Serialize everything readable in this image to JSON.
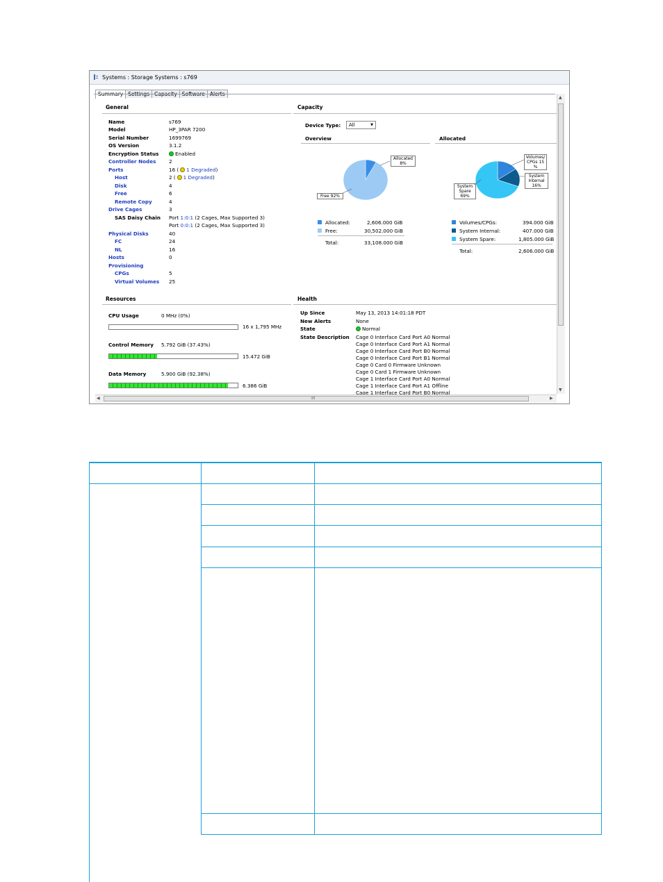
{
  "window": {
    "title": "Systems : Storage Systems : s769",
    "tabs": [
      "Summary",
      "Settings",
      "Capacity",
      "Software",
      "Alerts"
    ]
  },
  "general": {
    "heading": "General",
    "name_label": "Name",
    "name": "s769",
    "model_label": "Model",
    "model": "HP_3PAR 7200",
    "serial_label": "Serial Number",
    "serial": "1699769",
    "os_label": "OS Version",
    "os": "3.1.2",
    "encryption_label": "Encryption Status",
    "encryption": "Enabled",
    "controller_nodes_label": "Controller Nodes",
    "controller_nodes": "2",
    "ports_label": "Ports",
    "ports_count": "16 (",
    "ports_degraded": "1 Degraded",
    "ports_close": ")",
    "host_label": "Host",
    "host_count": "2 (",
    "host_degraded": "1 Degraded",
    "host_close": ")",
    "disk_label": "Disk",
    "disk": "4",
    "free_label": "Free",
    "free": "6",
    "remote_copy_label": "Remote Copy",
    "remote_copy": "4",
    "drive_cages_label": "Drive Cages",
    "drive_cages": "3",
    "sas_label": "SAS Daisy Chain",
    "sas_port_word": "Port ",
    "sas_link1": "1:0:1",
    "sas_rest1": " (2 Cages, Max Supported 3)",
    "sas_link2": "0:0:1",
    "sas_rest2": " (2 Cages, Max Supported 3)",
    "physical_disks_label": "Physical Disks",
    "physical_disks": "40",
    "fc_label": "FC",
    "fc": "24",
    "nl_label": "NL",
    "nl": "16",
    "hosts_label": "Hosts",
    "hosts": "0",
    "provisioning_label": "Provisioning",
    "cpgs_label": "CPGs",
    "cpgs": "5",
    "vv_label": "Virtual Volumes",
    "vv": "25"
  },
  "resources": {
    "heading": "Resources",
    "cpu_label": "CPU Usage",
    "cpu_value": "0 MHz (0%)",
    "cpu_max": "16 x 1,795 MHz",
    "cpu_fraction": 0.0,
    "control_label": "Control Memory",
    "control_value": "5.792 GiB (37.43%)",
    "control_max": "15.472 GiB",
    "control_fraction": 0.3743,
    "data_label": "Data Memory",
    "data_value": "5.900 GiB (92.38%)",
    "data_max": "6.386 GiB",
    "data_fraction": 0.9238
  },
  "capacity": {
    "heading": "Capacity",
    "device_type_label": "Device Type:",
    "device_type_value": "All",
    "overview_heading": "Overview",
    "allocated_heading": "Allocated",
    "overview_callout_alloc": "Allocated 8%",
    "overview_callout_free": "Free 92%",
    "overview_legend": [
      {
        "label": "Allocated:",
        "value": "2,606.000 GiB",
        "color": "#3b8ee8"
      },
      {
        "label": "Free:",
        "value": "30,502.000 GiB",
        "color": "#9ccaf5"
      }
    ],
    "overview_total_label": "Total:",
    "overview_total": "33,108.000 GiB",
    "allocated_callout_vol": "Volumes/ CPGs 15 %",
    "allocated_callout_int": "System Internal 16%",
    "allocated_callout_spare": "System Spare 69%",
    "allocated_legend": [
      {
        "label": "Volumes/CPGs:",
        "value": "394.000 GiB",
        "color": "#2e86de"
      },
      {
        "label": "System Internal:",
        "value": "407.000 GiB",
        "color": "#0b5b8e"
      },
      {
        "label": "System Spare:",
        "value": "1,805.000 GiB",
        "color": "#35c6f5"
      }
    ],
    "allocated_total_label": "Total:",
    "allocated_total": "2,606.000 GiB"
  },
  "health": {
    "heading": "Health",
    "up_since_label": "Up Since",
    "up_since": "May 13, 2013 14:01:18 PDT",
    "new_alerts_label": "New Alerts",
    "new_alerts": "None",
    "state_label": "State",
    "state": "Normal",
    "state_desc_label": "State Description",
    "state_desc": [
      "Cage 0 Interface Card Port A0 Normal",
      "Cage 0 Interface Card Port A1 Normal",
      "Cage 0 Interface Card Port B0 Normal",
      "Cage 0 Interface Card Port B1 Normal",
      "Cage 0 Card 0 Firmware Unknown",
      "Cage 0 Card 1 Firmware Unknown",
      "Cage 1 Interface Card Port A0 Normal",
      "Cage 1 Interface Card Port A1 Offline",
      "Cage 1 Interface Card Port B0 Normal"
    ]
  },
  "scrollbar": {
    "h_grip": "III"
  }
}
